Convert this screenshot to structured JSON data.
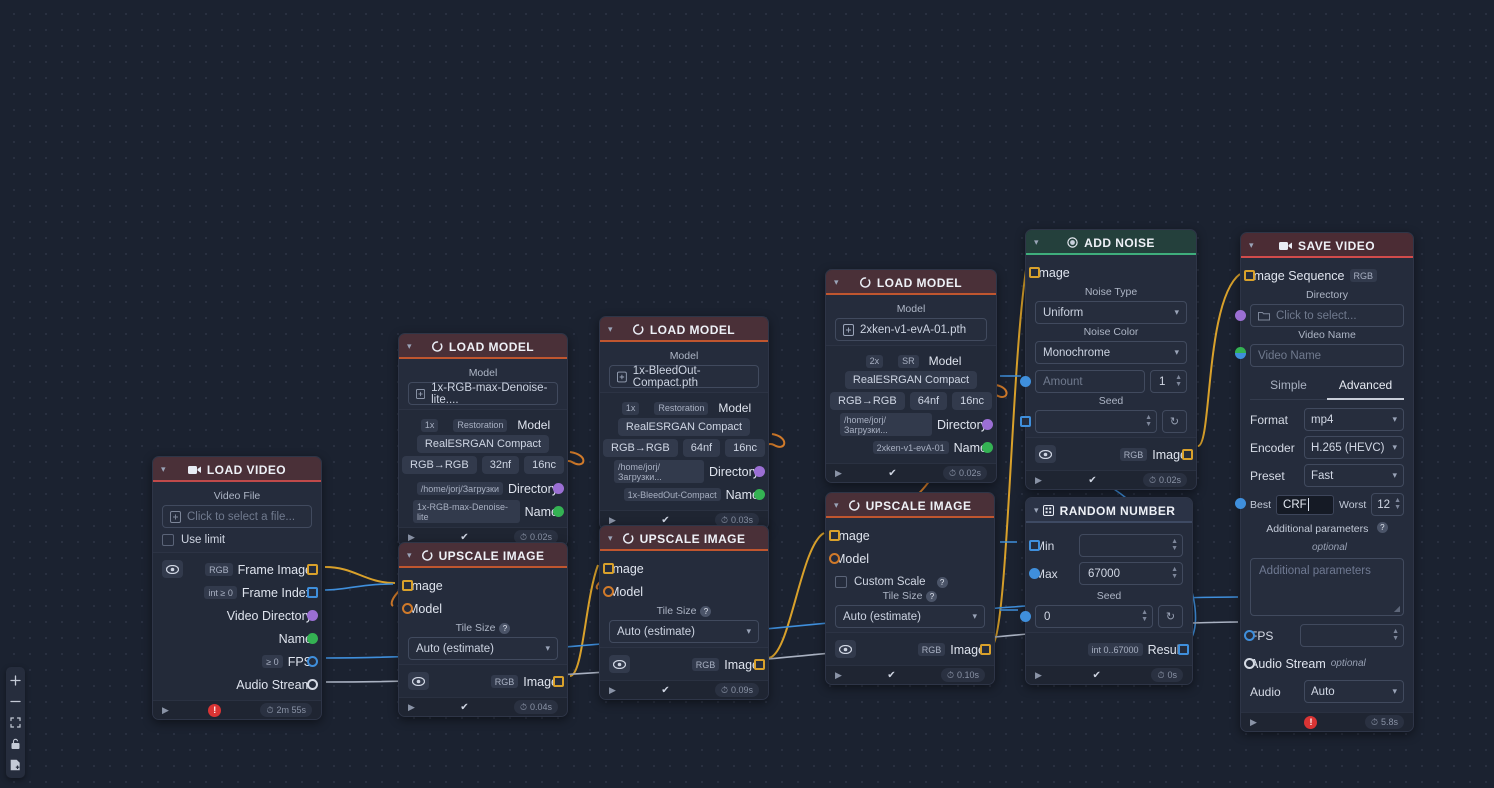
{
  "canvas": {
    "background": "#1b2230",
    "grid_color": "#2a3142"
  },
  "toolbar": {
    "buttons": [
      {
        "name": "zoom-in-icon",
        "glyph": "+"
      },
      {
        "name": "zoom-out-icon",
        "glyph": "−"
      },
      {
        "name": "fit-view-icon",
        "glyph": "⛶"
      },
      {
        "name": "lock-icon",
        "glyph": "🔓"
      },
      {
        "name": "add-node-icon",
        "glyph": "🗎"
      }
    ]
  },
  "nodes": {
    "load_video": {
      "title": "LOAD VIDEO",
      "icon": "video-camera-icon",
      "accent": "#c04a4a",
      "file_label": "Video File",
      "file_placeholder": "Click to select a file...",
      "use_limit_label": "Use limit",
      "outputs": [
        {
          "tag": "RGB",
          "label": "Frame Image",
          "handle": "square-yellow"
        },
        {
          "tag": "int ≥ 0",
          "label": "Frame Index",
          "handle": "square-blue"
        },
        {
          "tag": "",
          "label": "Video Directory",
          "handle": "dot-purple"
        },
        {
          "tag": "",
          "label": "Name",
          "handle": "dot-green"
        },
        {
          "tag": "≥ 0",
          "label": "FPS",
          "handle": "circle-blue"
        },
        {
          "tag": "",
          "label": "Audio Stream",
          "handle": "circle-white"
        }
      ],
      "footer": {
        "status": "error",
        "time": "2m 55s"
      }
    },
    "load_model_1": {
      "title": "LOAD MODEL",
      "icon": "model-icon",
      "accent": "#c0562f",
      "model_label": "Model",
      "model_value": "1x-RGB-max-Denoise-lite....",
      "tags": [
        "1x",
        "Restoration",
        "Model"
      ],
      "arch": "RealESRGAN Compact",
      "specs": [
        "RGB→RGB",
        "32nf",
        "16nc"
      ],
      "directory_value": "/home/jorj/Загрузки",
      "directory_label": "Directory",
      "name_value": "1x-RGB-max-Denoise-lite",
      "name_label": "Name",
      "footer": {
        "status": "ok",
        "time": "0.02s"
      }
    },
    "upscale_1": {
      "title": "UPSCALE IMAGE",
      "icon": "model-icon",
      "accent": "#c0562f",
      "inputs": [
        {
          "label": "Image",
          "handle": "square-yellow"
        },
        {
          "label": "Model",
          "handle": "circle-orange"
        }
      ],
      "tile_label": "Tile Size",
      "tile_value": "Auto (estimate)",
      "output": {
        "tag": "RGB",
        "label": "Image",
        "handle": "square-yellow"
      },
      "footer": {
        "status": "ok",
        "time": "0.04s"
      }
    },
    "load_model_2": {
      "title": "LOAD MODEL",
      "icon": "model-icon",
      "accent": "#c0562f",
      "model_label": "Model",
      "model_value": "1x-BleedOut-Compact.pth",
      "tags": [
        "1x",
        "Restoration",
        "Model"
      ],
      "arch": "RealESRGAN Compact",
      "specs": [
        "RGB→RGB",
        "64nf",
        "16nc"
      ],
      "directory_value": "/home/jorj/Загрузки...",
      "directory_label": "Directory",
      "name_value": "1x-BleedOut-Compact",
      "name_label": "Name",
      "footer": {
        "status": "ok",
        "time": "0.03s"
      }
    },
    "upscale_2": {
      "title": "UPSCALE IMAGE",
      "icon": "model-icon",
      "accent": "#c0562f",
      "inputs": [
        {
          "label": "Image",
          "handle": "square-yellow"
        },
        {
          "label": "Model",
          "handle": "circle-orange"
        }
      ],
      "tile_label": "Tile Size",
      "tile_value": "Auto (estimate)",
      "output": {
        "tag": "RGB",
        "label": "Image",
        "handle": "square-yellow"
      },
      "footer": {
        "status": "ok",
        "time": "0.09s"
      }
    },
    "load_model_3": {
      "title": "LOAD MODEL",
      "icon": "model-icon",
      "accent": "#c0562f",
      "model_label": "Model",
      "model_value": "2xken-v1-evA-01.pth",
      "tags": [
        "2x",
        "SR",
        "Model"
      ],
      "arch": "RealESRGAN Compact",
      "specs": [
        "RGB→RGB",
        "64nf",
        "16nc"
      ],
      "directory_value": "/home/jorj/Загрузки...",
      "directory_label": "Directory",
      "name_value": "2xken-v1-evA-01",
      "name_label": "Name",
      "footer": {
        "status": "ok",
        "time": "0.02s"
      }
    },
    "upscale_3": {
      "title": "UPSCALE IMAGE",
      "icon": "model-icon",
      "accent": "#c0562f",
      "inputs": [
        {
          "label": "Image",
          "handle": "square-yellow"
        },
        {
          "label": "Model",
          "handle": "circle-orange"
        }
      ],
      "custom_scale_label": "Custom Scale",
      "tile_label": "Tile Size",
      "tile_value": "Auto (estimate)",
      "output": {
        "tag": "RGB",
        "label": "Image",
        "handle": "square-yellow"
      },
      "footer": {
        "status": "ok",
        "time": "0.10s"
      }
    },
    "add_noise": {
      "title": "ADD NOISE",
      "icon": "noise-icon",
      "accent": "#3fae7c",
      "input_image_label": "Image",
      "noise_type_label": "Noise Type",
      "noise_type_value": "Uniform",
      "noise_color_label": "Noise Color",
      "noise_color_value": "Monochrome",
      "amount_placeholder": "Amount",
      "amount_value": "1",
      "seed_label": "Seed",
      "seed_value": "",
      "output": {
        "tag": "RGB",
        "label": "Image",
        "handle": "square-yellow"
      },
      "footer": {
        "status": "ok",
        "time": "0.02s"
      }
    },
    "random_number": {
      "title": "RANDOM NUMBER",
      "icon": "grid-icon",
      "accent": "#3e4a63",
      "min_label": "Min",
      "min_value": "",
      "max_label": "Max",
      "max_value": "67000",
      "seed_label": "Seed",
      "seed_value": "0",
      "output": {
        "tag": "int 0..67000",
        "label": "Result",
        "handle": "square-blue"
      },
      "footer": {
        "status": "ok",
        "time": "0s"
      }
    },
    "save_video": {
      "title": "SAVE VIDEO",
      "icon": "video-camera-icon",
      "accent": "#d24b4b",
      "image_sequence_label": "Image Sequence",
      "image_sequence_tag": "RGB",
      "directory_label": "Directory",
      "directory_placeholder": "Click to select...",
      "video_name_label": "Video Name",
      "video_name_placeholder": "Video Name",
      "tabs": [
        {
          "label": "Simple",
          "active": false
        },
        {
          "label": "Advanced",
          "active": true
        }
      ],
      "format_label": "Format",
      "format_value": "mp4",
      "encoder_label": "Encoder",
      "encoder_value": "H.265 (HEVC)",
      "preset_label": "Preset",
      "preset_value": "Fast",
      "crf_best_label": "Best",
      "crf_value": "CRF",
      "crf_worst_label": "Worst",
      "crf_worst_value": "12",
      "additional_label": "Additional parameters",
      "additional_optional": "optional",
      "additional_placeholder": "Additional parameters",
      "fps_label": "FPS",
      "fps_value": "",
      "audio_stream_label": "Audio Stream",
      "audio_stream_optional": "optional",
      "audio_label": "Audio",
      "audio_value": "Auto",
      "footer": {
        "status": "error",
        "time": "5.8s"
      }
    }
  }
}
